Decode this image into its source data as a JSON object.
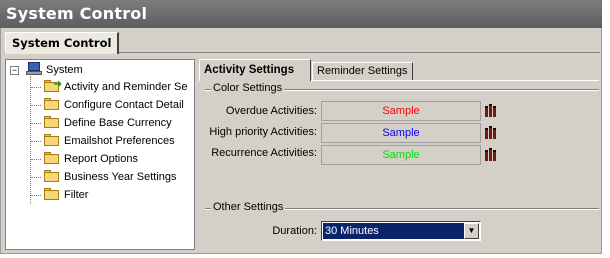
{
  "window": {
    "title": "System Control"
  },
  "outer_tab": {
    "label": "System Control"
  },
  "tree": {
    "root": {
      "label": "System",
      "expander": "⊟",
      "icon": "computer-icon"
    },
    "items": [
      {
        "label": "Activity and Reminder Se",
        "icon": "folder-arrow-icon"
      },
      {
        "label": "Configure Contact Detail",
        "icon": "folder-icon"
      },
      {
        "label": "Define Base Currency",
        "icon": "folder-icon"
      },
      {
        "label": "Emailshot Preferences",
        "icon": "folder-icon"
      },
      {
        "label": "Report Options",
        "icon": "folder-icon"
      },
      {
        "label": "Business Year Settings",
        "icon": "folder-icon"
      },
      {
        "label": "Filter",
        "icon": "folder-icon"
      }
    ]
  },
  "tabs": [
    {
      "label": "Activity Settings",
      "active": true
    },
    {
      "label": "Reminder Settings",
      "active": false
    }
  ],
  "color_settings": {
    "group_label": "Color Settings",
    "rows": [
      {
        "label": "Overdue Activities:",
        "sample": "Sample",
        "color": "#ff0000",
        "picker_icon": "color-picker-icon"
      },
      {
        "label": "High priority Activities:",
        "sample": "Sample",
        "color": "#0000ff",
        "picker_icon": "color-picker-icon"
      },
      {
        "label": "Recurrence Activities:",
        "sample": "Sample",
        "color": "#00e000",
        "picker_icon": "color-picker-icon"
      }
    ]
  },
  "other_settings": {
    "group_label": "Other Settings",
    "duration_label": "Duration:",
    "duration_value": "30 Minutes",
    "dropdown_icon": "chevron-down-icon"
  }
}
